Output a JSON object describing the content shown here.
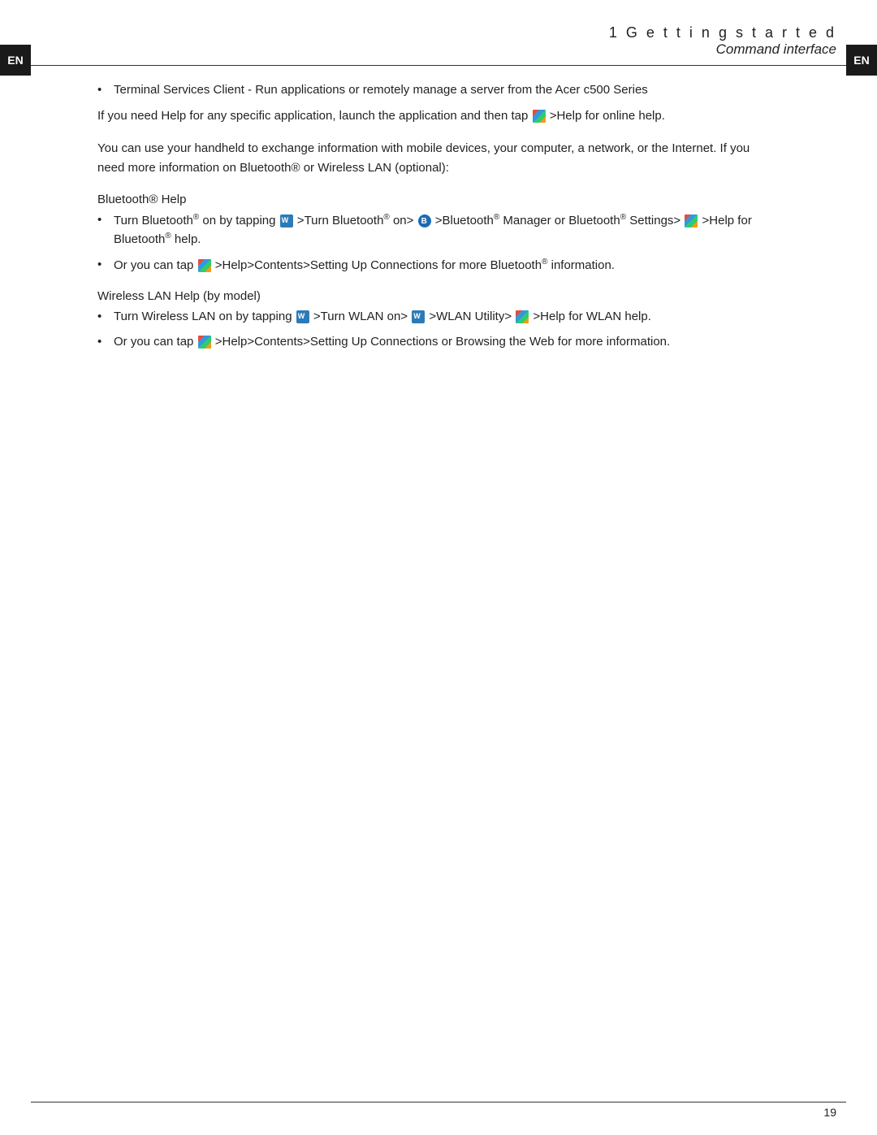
{
  "page": {
    "number": "19",
    "header": {
      "title": "1  G e t t i n g  s t a r t e d",
      "subtitle": "Command interface"
    },
    "side_label": "EN"
  },
  "content": {
    "bullet_intro": [
      "Terminal Services Client - Run applications or remotely manage a server from the Acer c500 Series"
    ],
    "help_paragraph": "If you need Help for any specific application, launch the application and then tap",
    "help_inline": ">Help for online help.",
    "exchange_paragraph": "You can use your handheld to exchange information with mobile devices, your computer, a network, or the Internet. If you need more information on Bluetooth® or Wireless LAN (optional):",
    "bluetooth_heading": "Bluetooth® Help",
    "bluetooth_bullets": [
      {
        "text_before": "Turn Bluetooth® on by tapping",
        "icon1": "bluetooth-phone-icon",
        "text_mid1": ">Turn Bluetooth® on>",
        "icon2": "bluetooth-icon",
        "text_mid2": ">Bluetooth® Manager or Bluetooth® Settings>",
        "icon3": "windows-icon",
        "text_after": ">Help for Bluetooth® help."
      },
      {
        "text_before": "Or you can tap",
        "icon1": "windows-icon",
        "text_after": ">Help>Contents>Setting Up Connections for more Bluetooth® information."
      }
    ],
    "wlan_heading": "Wireless LAN Help (by model)",
    "wlan_bullets": [
      {
        "text_before": "Turn Wireless LAN on by tapping",
        "icon1": "wlan-icon",
        "text_mid1": ">Turn WLAN on>",
        "icon2": "wlan-icon",
        "text_mid2": ">WLAN Utility>",
        "icon3": "windows-icon",
        "text_after": ">Help for WLAN help."
      },
      {
        "text_before": "Or you can tap",
        "icon1": "windows-icon",
        "text_after": ">Help>Contents>Setting Up Connections or Browsing the Web for more information."
      }
    ]
  }
}
